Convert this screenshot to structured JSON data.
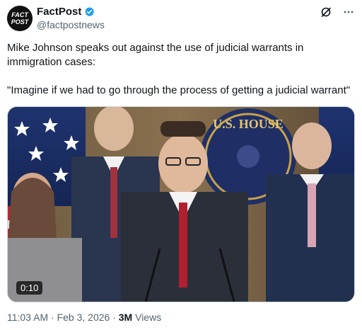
{
  "author": {
    "display_name": "FactPost",
    "handle": "@factpostnews",
    "avatar_text_line1": "FACT",
    "avatar_text_line2": "POST"
  },
  "post": {
    "line1": "Mike Johnson speaks out against the use of judicial warrants in immigration cases:",
    "line2": "\"Imagine if we had to go through the process of getting a judicial warrant\""
  },
  "media": {
    "duration": "0:10",
    "seal_text": "U.S. HOUSE"
  },
  "meta": {
    "time": "11:03 AM",
    "separator": "·",
    "date": "Feb 3, 2026",
    "views_count": "3M",
    "views_label": "Views"
  },
  "icons": {
    "verified": "verified-badge-icon",
    "grok": "grok-icon",
    "more": "more-options-icon"
  },
  "colors": {
    "verified_blue": "#1d9bf0",
    "muted_text": "#536471",
    "text": "#0f1419"
  }
}
